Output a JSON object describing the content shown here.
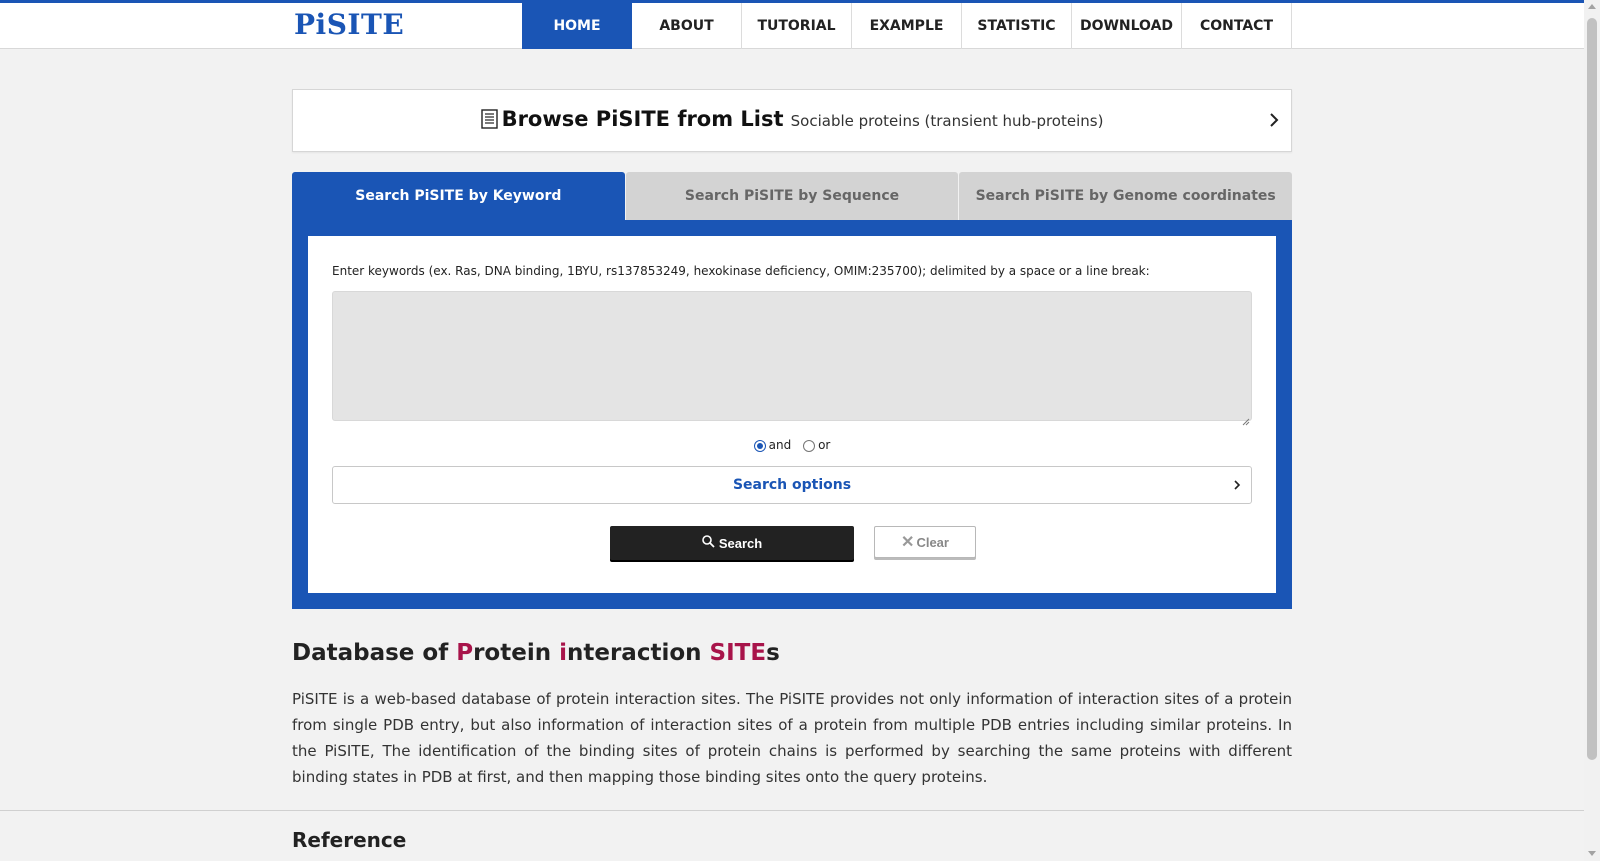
{
  "header": {
    "logo": "PiSITE",
    "nav": [
      {
        "label": "HOME",
        "active": true
      },
      {
        "label": "ABOUT",
        "active": false
      },
      {
        "label": "TUTORIAL",
        "active": false
      },
      {
        "label": "EXAMPLE",
        "active": false
      },
      {
        "label": "STATISTIC",
        "active": false
      },
      {
        "label": "DOWNLOAD",
        "active": false
      },
      {
        "label": "CONTACT",
        "active": false
      }
    ]
  },
  "browse": {
    "title": "Browse PiSITE from List",
    "subtitle": "Sociable proteins (transient hub-proteins)"
  },
  "search": {
    "tabs": [
      {
        "label": "Search PiSITE by Keyword",
        "active": true
      },
      {
        "label": "Search PiSITE by Sequence",
        "active": false
      },
      {
        "label": "Search PiSITE by Genome coordinates",
        "active": false
      }
    ],
    "keyword_label": "Enter keywords (ex. Ras, DNA binding, 1BYU, rs137853249, hexokinase deficiency, OMIM:235700); delimited by a space or a line break:",
    "keyword_value": "",
    "logic_options": [
      {
        "label": "and",
        "selected": true
      },
      {
        "label": "or",
        "selected": false
      }
    ],
    "options_label": "Search options",
    "search_button": "Search",
    "clear_button": "Clear"
  },
  "intro": {
    "heading_parts": [
      "Database of ",
      "P",
      "rotein ",
      "i",
      "nteraction ",
      "SITE",
      "s"
    ],
    "description": "PiSITE is a web-based database of protein interaction sites. The PiSITE provides not only information of interaction sites of a protein from single PDB entry, but also information of interaction sites of a protein from multiple PDB entries including similar proteins. In the PiSITE, The identification of the binding sites of protein chains is performed by searching the same proteins with different binding states in PDB at first, and then mapping those binding sites onto the query proteins."
  },
  "reference": {
    "heading": "Reference"
  },
  "colors": {
    "brand": "#1a55b5",
    "highlight": "#a8144a",
    "dark_button": "#222222"
  }
}
